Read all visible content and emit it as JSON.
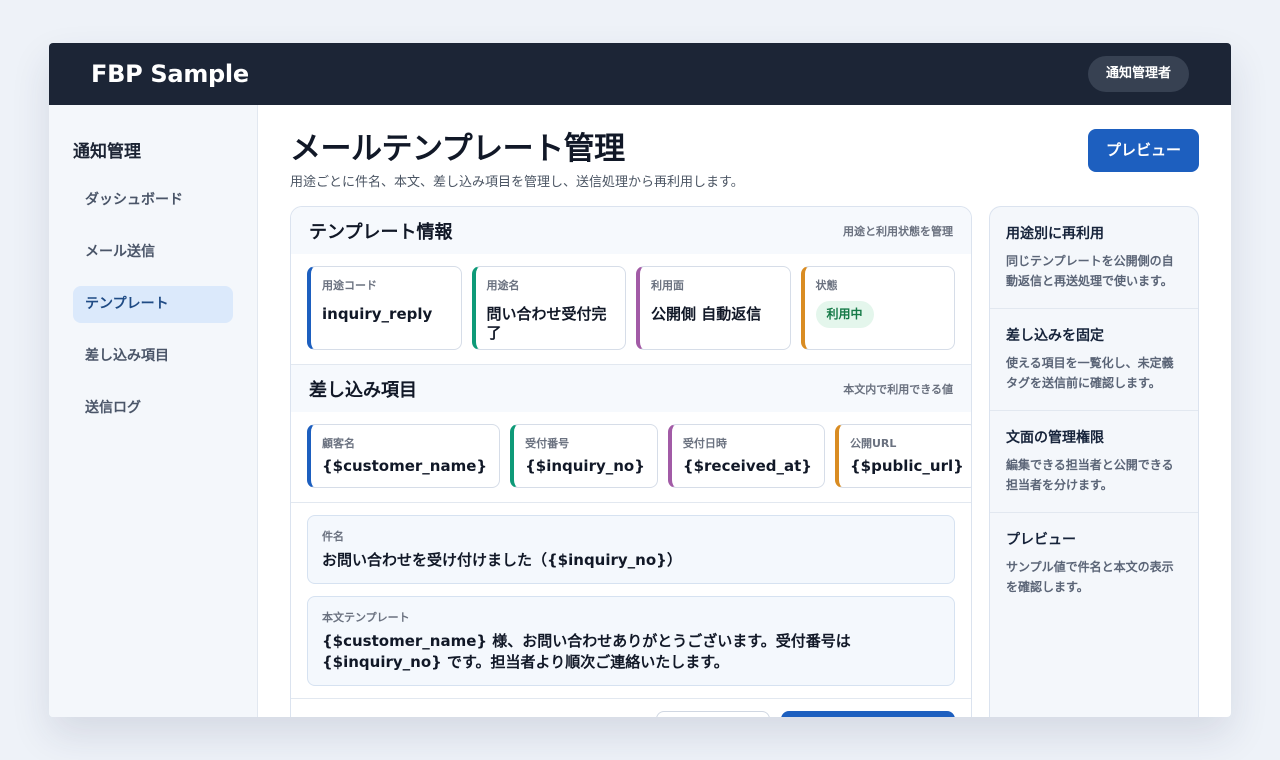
{
  "header": {
    "brand": "FBP Sample",
    "user_role": "通知管理者"
  },
  "sidebar": {
    "title": "通知管理",
    "items": [
      {
        "label": "ダッシュボード",
        "active": false
      },
      {
        "label": "メール送信",
        "active": false
      },
      {
        "label": "テンプレート",
        "active": true
      },
      {
        "label": "差し込み項目",
        "active": false
      },
      {
        "label": "送信ログ",
        "active": false
      }
    ]
  },
  "page": {
    "title": "メールテンプレート管理",
    "subtitle": "用途ごとに件名、本文、差し込み項目を管理し、送信処理から再利用します。",
    "preview_button": "プレビュー"
  },
  "template_info": {
    "title": "テンプレート情報",
    "note": "用途と利用状態を管理",
    "tiles": [
      {
        "label": "用途コード",
        "value": "inquiry_reply"
      },
      {
        "label": "用途名",
        "value": "問い合わせ受付完了"
      },
      {
        "label": "利用面",
        "value": "公開側 自動返信"
      },
      {
        "label": "状態",
        "value": "利用中"
      }
    ]
  },
  "merge_fields": {
    "title": "差し込み項目",
    "note": "本文内で利用できる値",
    "tiles": [
      {
        "label": "顧客名",
        "value": "{$customer_name}"
      },
      {
        "label": "受付番号",
        "value": "{$inquiry_no}"
      },
      {
        "label": "受付日時",
        "value": "{$received_at}"
      },
      {
        "label": "公開URL",
        "value": "{$public_url}"
      }
    ]
  },
  "subject": {
    "label": "件名",
    "value": "お問い合わせを受け付けました（{$inquiry_no}）"
  },
  "body_template": {
    "label": "本文テンプレート",
    "value": "{$customer_name} 様、お問い合わせありがとうございます。受付番号は {$inquiry_no} です。担当者より順次ご連絡いたします。"
  },
  "aside": [
    {
      "title": "用途別に再利用",
      "text": "同じテンプレートを公開側の自動返信と再送処理で使います。"
    },
    {
      "title": "差し込みを固定",
      "text": "使える項目を一覧化し、未定義タグを送信前に確認します。"
    },
    {
      "title": "文面の管理権限",
      "text": "編集できる担当者と公開できる担当者を分けます。"
    },
    {
      "title": "プレビュー",
      "text": "サンプル値で件名と本文の表示を確認します。"
    }
  ],
  "colors": {
    "topbar": "#1c2536",
    "accent": "#1d5fbf",
    "status_active_bg": "#e4f6ec",
    "status_active_text": "#167a48"
  }
}
